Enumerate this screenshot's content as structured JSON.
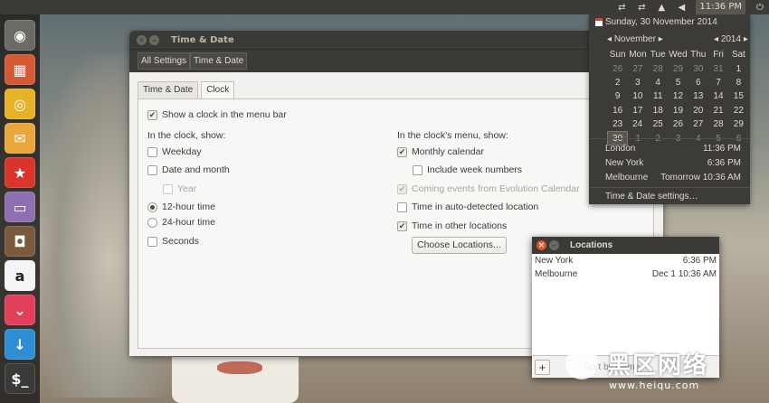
{
  "topbar": {
    "time": "11:36 PM",
    "icons": [
      "network-transfer-icon",
      "network-transfer-icon",
      "notification-icon",
      "volume-icon",
      "power-icon"
    ]
  },
  "launcher": {
    "items": [
      {
        "name": "ubuntu-dash-icon",
        "color": "#6b6a66",
        "glyph": "◉"
      },
      {
        "name": "apps-grid-icon",
        "color": "#d35a35",
        "glyph": "▦"
      },
      {
        "name": "chrome-icon",
        "color": "#e7b228",
        "glyph": "◎"
      },
      {
        "name": "mail-icon",
        "color": "#e8a73b",
        "glyph": "✉"
      },
      {
        "name": "star-app-icon",
        "color": "#d9352c",
        "glyph": "★"
      },
      {
        "name": "folder-icon",
        "color": "#8e6fb0",
        "glyph": "▭"
      },
      {
        "name": "instagram-icon",
        "color": "#7a5a3d",
        "glyph": "◘"
      },
      {
        "name": "amazon-icon",
        "color": "#f4f4f4",
        "glyph": "a"
      },
      {
        "name": "pocket-icon",
        "color": "#e2405a",
        "glyph": "⌄"
      },
      {
        "name": "download-icon",
        "color": "#2f8fd5",
        "glyph": "↓"
      },
      {
        "name": "terminal-icon",
        "color": "#3a3a3a",
        "glyph": "$_"
      }
    ]
  },
  "settings_window": {
    "title": "Time & Date",
    "breadcrumbs": [
      "All Settings",
      "Time & Date"
    ],
    "tabs": [
      "Time & Date",
      "Clock"
    ],
    "show_clock_label": "Show a clock in the menu bar",
    "in_clock_heading": "In the clock, show:",
    "weekday": "Weekday",
    "date_and_month": "Date and month",
    "year": "Year",
    "hour12": "12-hour time",
    "hour24": "24-hour time",
    "seconds": "Seconds",
    "in_menu_heading": "In the clock's menu, show:",
    "monthly_calendar": "Monthly calendar",
    "week_numbers": "Include week numbers",
    "evolution_events": "Coming events from Evolution Calendar",
    "auto_location": "Time in auto-detected location",
    "other_locations": "Time in other locations",
    "choose_locations": "Choose Locations..."
  },
  "menu": {
    "date_header": "Sunday, 30 November 2014",
    "month": "November",
    "year": "2014",
    "weekdays": [
      "Sun",
      "Mon",
      "Tue",
      "Wed",
      "Thu",
      "Fri",
      "Sat"
    ],
    "weeks": [
      [
        {
          "d": "26",
          "dim": true
        },
        {
          "d": "27",
          "dim": true
        },
        {
          "d": "28",
          "dim": true
        },
        {
          "d": "29",
          "dim": true
        },
        {
          "d": "30",
          "dim": true
        },
        {
          "d": "31",
          "dim": true
        },
        {
          "d": "1"
        }
      ],
      [
        {
          "d": "2"
        },
        {
          "d": "3"
        },
        {
          "d": "4"
        },
        {
          "d": "5"
        },
        {
          "d": "6"
        },
        {
          "d": "7"
        },
        {
          "d": "8"
        }
      ],
      [
        {
          "d": "9"
        },
        {
          "d": "10"
        },
        {
          "d": "11"
        },
        {
          "d": "12"
        },
        {
          "d": "13"
        },
        {
          "d": "14"
        },
        {
          "d": "15"
        }
      ],
      [
        {
          "d": "16"
        },
        {
          "d": "17"
        },
        {
          "d": "18"
        },
        {
          "d": "19"
        },
        {
          "d": "20"
        },
        {
          "d": "21"
        },
        {
          "d": "22"
        }
      ],
      [
        {
          "d": "23"
        },
        {
          "d": "24"
        },
        {
          "d": "25"
        },
        {
          "d": "26"
        },
        {
          "d": "27"
        },
        {
          "d": "28"
        },
        {
          "d": "29"
        }
      ],
      [
        {
          "d": "30",
          "today": true
        },
        {
          "d": "1",
          "dim": true
        },
        {
          "d": "2",
          "dim": true
        },
        {
          "d": "3",
          "dim": true
        },
        {
          "d": "4",
          "dim": true
        },
        {
          "d": "5",
          "dim": true
        },
        {
          "d": "6",
          "dim": true
        }
      ]
    ],
    "locations": [
      {
        "city": "London",
        "time": "11:36 PM"
      },
      {
        "city": "New York",
        "time": "6:36 PM"
      },
      {
        "city": "Melbourne",
        "time": "Tomorrow 10:36 AM"
      }
    ],
    "settings_item": "Time & Date settings…"
  },
  "locations_window": {
    "title": "Locations",
    "rows": [
      {
        "city": "New York",
        "time": "6:36 PM"
      },
      {
        "city": "Melbourne",
        "time": "Dec 1 10:36 AM"
      }
    ],
    "add_label": "+",
    "sort_label": "Sort by Name"
  },
  "watermark": {
    "text": "黑区网络",
    "url": "www.heiqu.com"
  }
}
